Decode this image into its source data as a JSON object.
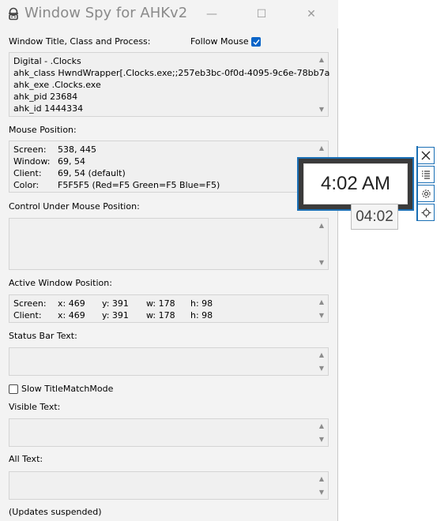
{
  "window": {
    "title": "Window Spy for AHKv2",
    "minimize_glyph": "—",
    "maximize_glyph": "☐",
    "close_glyph": "✕"
  },
  "section1": {
    "label": "Window Title, Class and Process:",
    "follow_mouse_label": "Follow Mouse",
    "follow_mouse_checked": true,
    "lines": [
      "Digital - .Clocks",
      "ahk_class HwndWrapper[.Clocks.exe;;257eb3bc-0f0d-4095-9c6e-78bb7a",
      "ahk_exe .Clocks.exe",
      "ahk_pid 23684",
      "ahk_id 1444334"
    ]
  },
  "mouse": {
    "label": "Mouse Position:",
    "rows": [
      {
        "key": "Screen:",
        "value": "538, 445"
      },
      {
        "key": "Window:",
        "value": "69, 54"
      },
      {
        "key": "Client:",
        "value": "69, 54 (default)"
      },
      {
        "key": "Color:",
        "value": "F5F5F5 (Red=F5 Green=F5 Blue=F5)"
      }
    ]
  },
  "control": {
    "label": "Control Under Mouse Position:"
  },
  "active": {
    "label": "Active Window Position:",
    "rows": [
      {
        "key": "Screen:",
        "x": "x: 469",
        "y": "y: 391",
        "w": "w: 178",
        "h": "h: 98"
      },
      {
        "key": "Client:",
        "x": "x: 469",
        "y": "y: 391",
        "w": "w: 178",
        "h": "h: 98"
      }
    ]
  },
  "status_bar": {
    "label": "Status Bar Text:"
  },
  "slow_mode": {
    "label": "Slow TitleMatchMode",
    "checked": false
  },
  "visible_text": {
    "label": "Visible Text:"
  },
  "all_text": {
    "label": "All Text:"
  },
  "footer": {
    "status": "(Updates suspended)"
  },
  "clock": {
    "time": "4:02 AM",
    "tooltip": "04:02"
  },
  "colors": {
    "accent": "#0a64c8",
    "clock_border": "#1a6fb5"
  }
}
